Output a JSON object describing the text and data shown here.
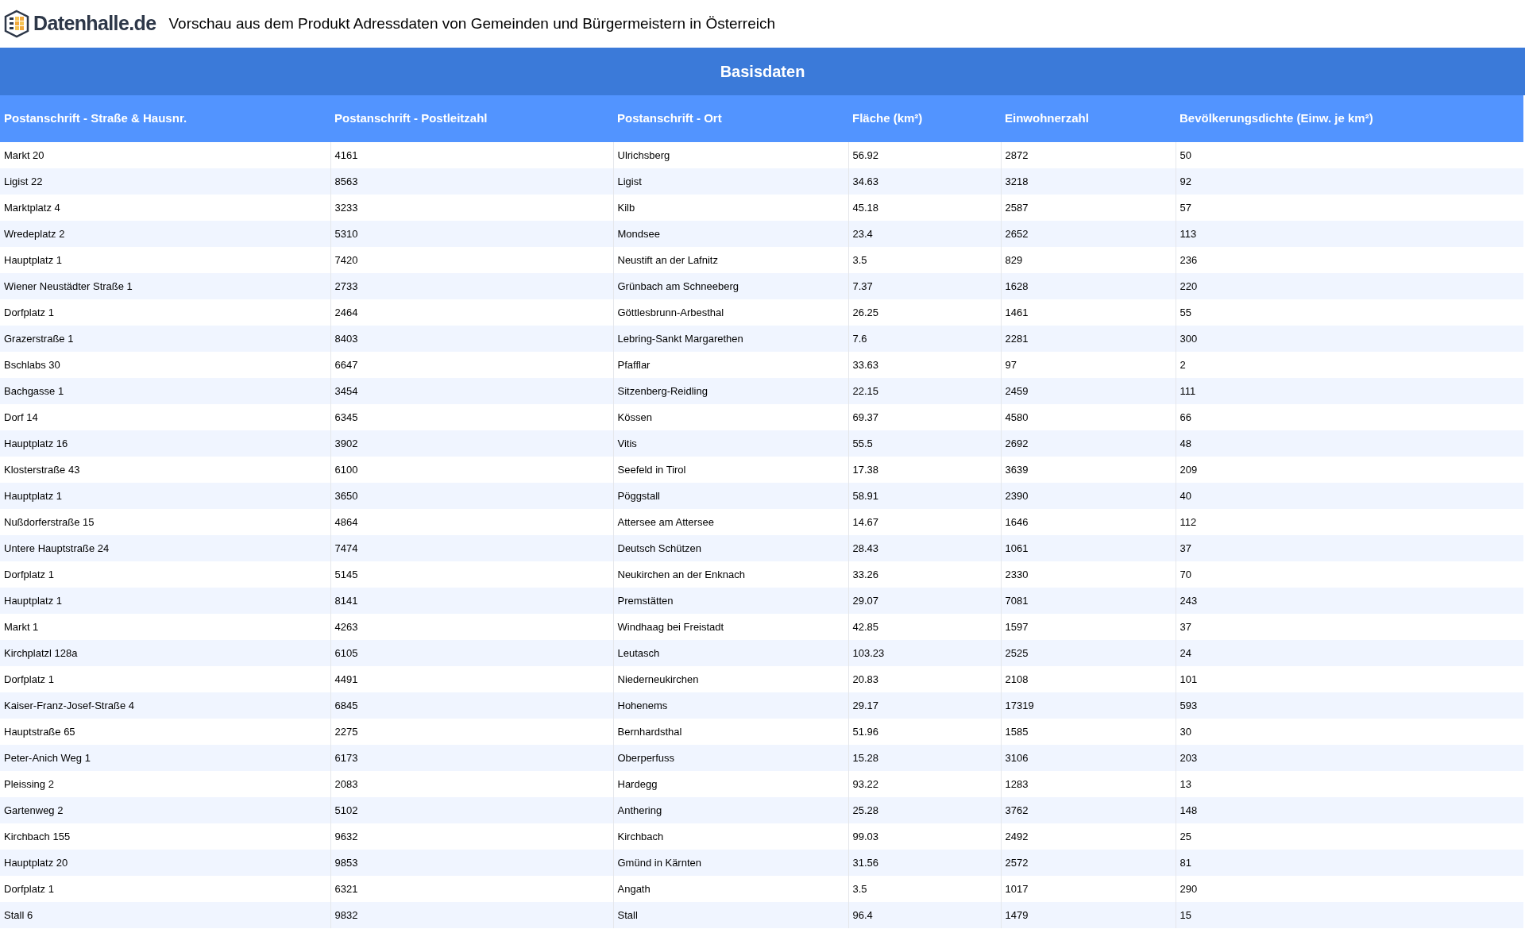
{
  "header": {
    "logo_text": "Datenhalle.de",
    "title": "Vorschau aus dem Produkt Adressdaten von Gemeinden und Bürgermeistern in Österreich"
  },
  "table": {
    "group_title": "Basisdaten",
    "columns": [
      "Postanschrift - Straße & Hausnr.",
      "Postanschrift - Postleitzahl",
      "Postanschrift - Ort",
      "Fläche (km²)",
      "Einwohnerzahl",
      "Bevölkerungsdichte (Einw. je km²)"
    ],
    "rows": [
      [
        "Markt 20",
        "4161",
        "Ulrichsberg",
        "56.92",
        "2872",
        "50"
      ],
      [
        "Ligist 22",
        "8563",
        "Ligist",
        "34.63",
        "3218",
        "92"
      ],
      [
        "Marktplatz 4",
        "3233",
        "Kilb",
        "45.18",
        "2587",
        "57"
      ],
      [
        "Wredeplatz 2",
        "5310",
        "Mondsee",
        "23.4",
        "2652",
        "113"
      ],
      [
        "Hauptplatz 1",
        "7420",
        "Neustift an der Lafnitz",
        "3.5",
        "829",
        "236"
      ],
      [
        "Wiener Neustädter Straße 1",
        "2733",
        "Grünbach am Schneeberg",
        "7.37",
        "1628",
        "220"
      ],
      [
        "Dorfplatz 1",
        "2464",
        "Göttlesbrunn-Arbesthal",
        "26.25",
        "1461",
        "55"
      ],
      [
        "Grazerstraße 1",
        "8403",
        "Lebring-Sankt Margarethen",
        "7.6",
        "2281",
        "300"
      ],
      [
        "Bschlabs 30",
        "6647",
        "Pfafflar",
        "33.63",
        "97",
        "2"
      ],
      [
        "Bachgasse 1",
        "3454",
        "Sitzenberg-Reidling",
        "22.15",
        "2459",
        "111"
      ],
      [
        "Dorf 14",
        "6345",
        "Kössen",
        "69.37",
        "4580",
        "66"
      ],
      [
        "Hauptplatz 16",
        "3902",
        "Vitis",
        "55.5",
        "2692",
        "48"
      ],
      [
        "Klosterstraße 43",
        "6100",
        "Seefeld in Tirol",
        "17.38",
        "3639",
        "209"
      ],
      [
        "Hauptplatz 1",
        "3650",
        "Pöggstall",
        "58.91",
        "2390",
        "40"
      ],
      [
        "Nußdorferstraße 15",
        "4864",
        "Attersee am Attersee",
        "14.67",
        "1646",
        "112"
      ],
      [
        "Untere Hauptstraße 24",
        "7474",
        "Deutsch Schützen",
        "28.43",
        "1061",
        "37"
      ],
      [
        "Dorfplatz 1",
        "5145",
        "Neukirchen an der Enknach",
        "33.26",
        "2330",
        "70"
      ],
      [
        "Hauptplatz 1",
        "8141",
        "Premstätten",
        "29.07",
        "7081",
        "243"
      ],
      [
        "Markt 1",
        "4263",
        "Windhaag bei Freistadt",
        "42.85",
        "1597",
        "37"
      ],
      [
        "Kirchplatzl 128a",
        "6105",
        "Leutasch",
        "103.23",
        "2525",
        "24"
      ],
      [
        "Dorfplatz 1",
        "4491",
        "Niederneukirchen",
        "20.83",
        "2108",
        "101"
      ],
      [
        "Kaiser-Franz-Josef-Straße 4",
        "6845",
        "Hohenems",
        "29.17",
        "17319",
        "593"
      ],
      [
        "Hauptstraße 65",
        "2275",
        "Bernhardsthal",
        "51.96",
        "1585",
        "30"
      ],
      [
        "Peter-Anich Weg 1",
        "6173",
        "Oberperfuss",
        "15.28",
        "3106",
        "203"
      ],
      [
        "Pleissing 2",
        "2083",
        "Hardegg",
        "93.22",
        "1283",
        "13"
      ],
      [
        "Gartenweg 2",
        "5102",
        "Anthering",
        "25.28",
        "3762",
        "148"
      ],
      [
        "Kirchbach 155",
        "9632",
        "Kirchbach",
        "99.03",
        "2492",
        "25"
      ],
      [
        "Hauptplatz 20",
        "9853",
        "Gmünd in Kärnten",
        "31.56",
        "2572",
        "81"
      ],
      [
        "Dorfplatz 1",
        "6321",
        "Angath",
        "3.5",
        "1017",
        "290"
      ],
      [
        "Stall 6",
        "9832",
        "Stall",
        "96.4",
        "1479",
        "15"
      ]
    ]
  }
}
